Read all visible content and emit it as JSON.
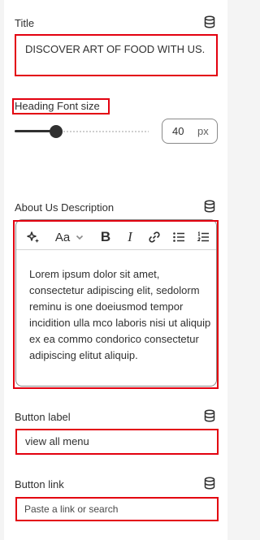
{
  "title_field": {
    "label": "Title",
    "value": "DISCOVER ART OF FOOD WITH US."
  },
  "heading_font_size": {
    "label": "Heading Font size",
    "value": "40",
    "unit": "px",
    "slider_fraction": 0.31
  },
  "about_description": {
    "label": "About Us Description",
    "font_size_label": "Aa",
    "body": "Lorem ipsum dolor sit amet, consectetur adipiscing elit, sedolorm reminu is one doeiusmod tempor incidition ulla mco laboris nisi ut aliquip ex ea commo condorico consectetur adipiscing elitut aliquip."
  },
  "button_label_field": {
    "label": "Button label",
    "value": "view all menu"
  },
  "button_link_field": {
    "label": "Button link",
    "placeholder": "Paste a link or search"
  },
  "icons": {
    "dynamic_source": "database-icon",
    "toolbar": [
      "magic-icon",
      "font-size-icon",
      "chevron-down-icon",
      "bold-icon",
      "italic-icon",
      "link-icon",
      "bullet-list-icon",
      "numbered-list-icon"
    ]
  },
  "colors": {
    "highlight": "#e3000f",
    "slider_fill": "#303030"
  }
}
